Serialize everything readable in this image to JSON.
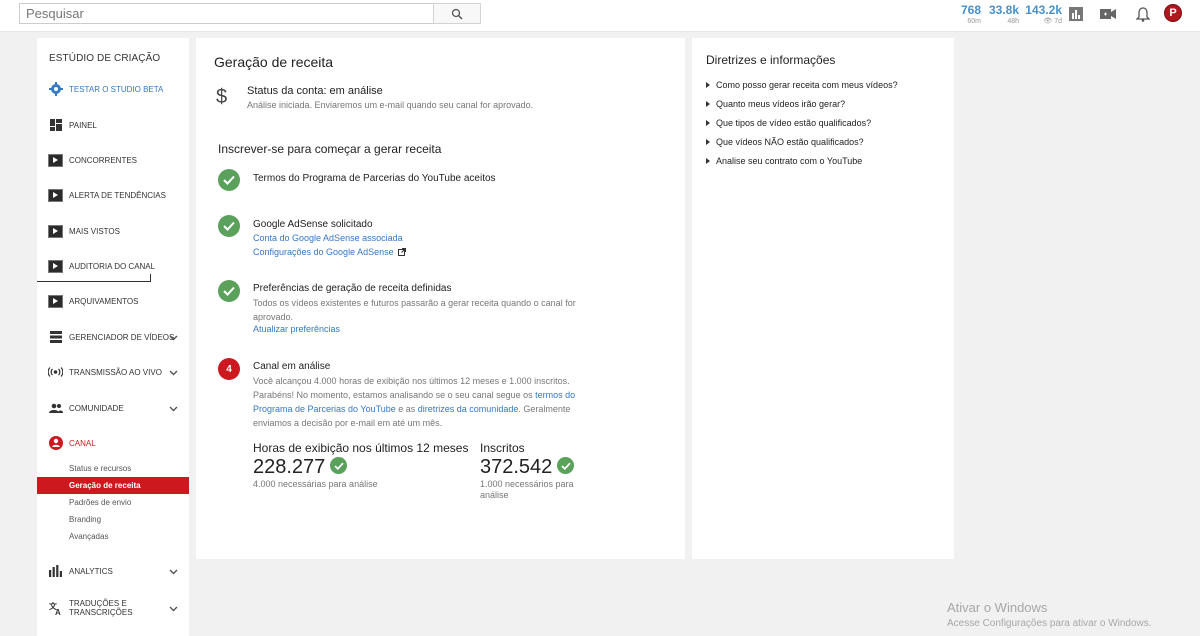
{
  "topbar": {
    "search_placeholder": "Pesquisar",
    "stats": [
      {
        "value": "768",
        "sub": "60m"
      },
      {
        "value": "33.8k",
        "sub": "48h"
      },
      {
        "value": "143.2k",
        "sub": "7d"
      }
    ],
    "avatar_letter": "P"
  },
  "sidebar": {
    "title": "ESTÚDIO DE CRIAÇÃO",
    "items": [
      {
        "label": "TESTAR O STUDIO BETA",
        "icon": "gear-icon"
      },
      {
        "label": "PAINEL",
        "icon": "dashboard-icon"
      },
      {
        "label": "CONCORRENTES",
        "icon": "tubebuddy-icon"
      },
      {
        "label": "ALERTA DE TENDÊNCIAS",
        "icon": "tubebuddy-icon"
      },
      {
        "label": "MAIS VISTOS",
        "icon": "tubebuddy-icon"
      },
      {
        "label": "AUDITORIA DO CANAL",
        "icon": "tubebuddy-icon"
      },
      {
        "label": "ARQUIVAMENTOS",
        "icon": "tubebuddy-icon"
      },
      {
        "label": "GERENCIADOR DE VÍDEOS",
        "icon": "video-manager-icon"
      },
      {
        "label": "TRANSMISSÃO AO VIVO",
        "icon": "live-icon"
      },
      {
        "label": "COMUNIDADE",
        "icon": "community-icon"
      },
      {
        "label": "CANAL",
        "icon": "channel-icon"
      },
      {
        "label": "ANALYTICS",
        "icon": "analytics-icon"
      },
      {
        "label": "TRADUÇÕES E TRANSCRIÇÕES",
        "icon": "translate-icon"
      }
    ],
    "channel_sub": [
      "Status e recursos",
      "Geração de receita",
      "Padrões de envio",
      "Branding",
      "Avançadas"
    ]
  },
  "main": {
    "title": "Geração de receita",
    "status_title": "Status da conta: em análise",
    "status_sub": "Análise iniciada. Enviaremos um e-mail quando seu canal for aprovado.",
    "subscribe_heading": "Inscrever-se para começar a gerar receita",
    "step1_title": "Termos do Programa de Parcerias do YouTube aceitos",
    "step2_title": "Google AdSense solicitado",
    "step2_link1": "Conta do Google AdSense associada",
    "step2_link2": "Configurações do Google AdSense",
    "step3_title": "Preferências de geração de receita definidas",
    "step3_text1": "Todos os vídeos existentes e futuros passarão a gerar receita quando o canal for",
    "step3_text2": "aprovado.",
    "step3_link": "Atualizar preferências",
    "step4_num": "4",
    "step4_title": "Canal em análise",
    "step4_line1": "Você alcançou 4.000 horas de exibição nos últimos 12 meses e 1.000 inscritos.",
    "step4_line2a": "Parabéns! No momento, estamos analisando se o seu canal segue os ",
    "step4_link_a": "termos do",
    "step4_link_b": "Programa de Parcerias do YouTube",
    "step4_line3b": " e as ",
    "step4_link_c": "diretrizes da comunidade",
    "step4_line3c": ". Geralmente",
    "step4_line4": "enviamos a decisão por e-mail em até um mês.",
    "hours_label": "Horas de exibição nos últimos 12 meses",
    "hours_value": "228.277",
    "hours_sub": "4.000 necessárias para análise",
    "subs_label": "Inscritos",
    "subs_value": "372.542",
    "subs_sub1": "1.000 necessários para",
    "subs_sub2": "análise"
  },
  "right": {
    "title": "Diretrizes e informações",
    "items": [
      "Como posso gerar receita com meus vídeos?",
      "Quanto meus vídeos irão gerar?",
      "Que tipos de vídeo estão qualificados?",
      "Que vídeos NÃO estão qualificados?",
      "Analise seu contrato com o YouTube"
    ]
  },
  "watermark": {
    "line1": "Ativar o Windows",
    "line2": "Acesse Configurações para ativar o Windows."
  },
  "colors": {
    "accent_red": "#cc181e",
    "link_blue": "#3478c6",
    "check_green": "#5aa15c",
    "stat_blue": "#4a90c9"
  }
}
